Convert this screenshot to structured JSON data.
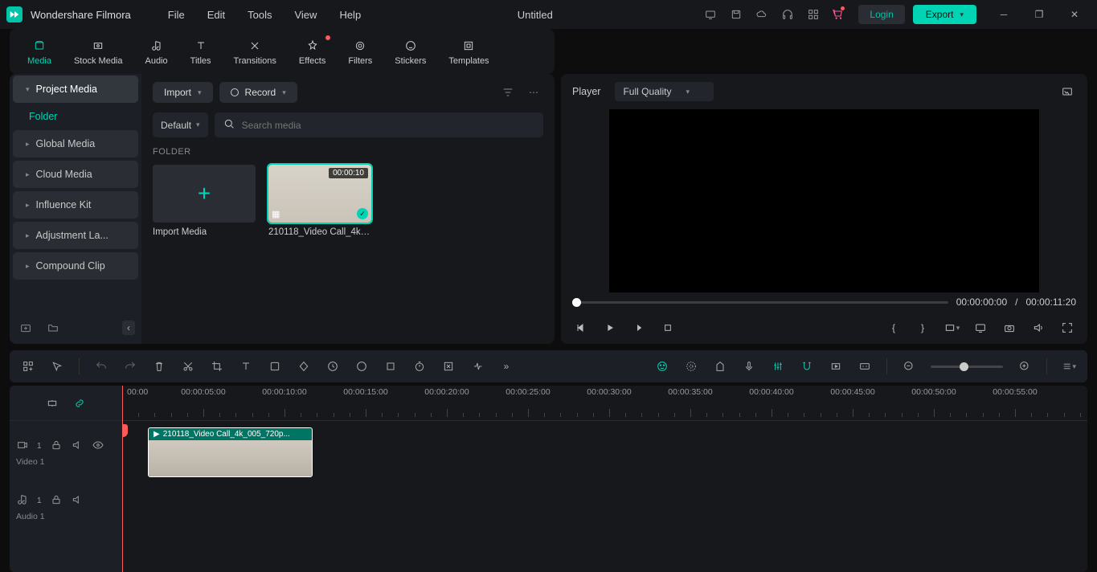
{
  "app": {
    "name": "Wondershare Filmora",
    "title": "Untitled"
  },
  "menu": [
    "File",
    "Edit",
    "Tools",
    "View",
    "Help"
  ],
  "header": {
    "login": "Login",
    "export": "Export"
  },
  "tabs": [
    {
      "label": "Media",
      "active": true
    },
    {
      "label": "Stock Media"
    },
    {
      "label": "Audio"
    },
    {
      "label": "Titles"
    },
    {
      "label": "Transitions"
    },
    {
      "label": "Effects",
      "dot": true
    },
    {
      "label": "Filters"
    },
    {
      "label": "Stickers"
    },
    {
      "label": "Templates"
    }
  ],
  "sidebar": {
    "items": [
      "Project Media",
      "Global Media",
      "Cloud Media",
      "Influence Kit",
      "Adjustment La...",
      "Compound Clip"
    ],
    "sub": "Folder"
  },
  "media": {
    "import": "Import",
    "record": "Record",
    "default": "Default",
    "search_placeholder": "Search media",
    "section": "FOLDER",
    "import_card": "Import Media",
    "clip_name": "210118_Video Call_4k_...",
    "clip_dur": "00:00:10"
  },
  "player": {
    "label": "Player",
    "quality": "Full Quality",
    "current": "00:00:00:00",
    "sep": "/",
    "total": "00:00:11:20"
  },
  "timeline": {
    "ruler": [
      "00:00:05:00",
      "00:00:10:00",
      "00:00:15:00",
      "00:00:20:00",
      "00:00:25:00",
      "00:00:30:00",
      "00:00:35:00",
      "00:00:40:00",
      "00:00:45:00",
      "00:00:50:00",
      "00:00:55:00"
    ],
    "ruler_start": "00:00",
    "video_track": "Video 1",
    "audio_track": "Audio 1",
    "clip_label": "210118_Video Call_4k_005_720p...",
    "v1": "1",
    "a1": "1"
  }
}
